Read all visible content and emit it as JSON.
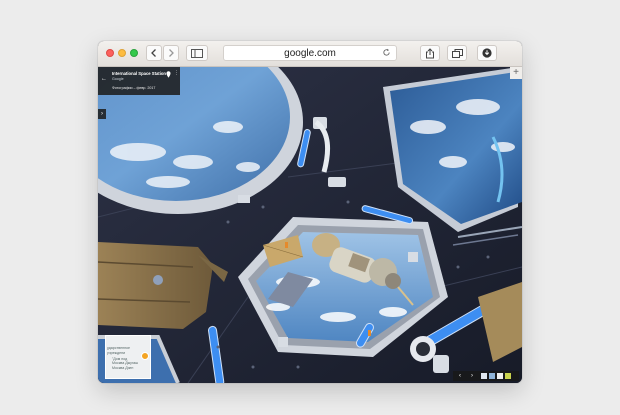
{
  "browser": {
    "url": "google.com",
    "icons": {
      "back": "chevron-left-icon",
      "forward": "chevron-right-icon",
      "sidebar": "sidebar-icon",
      "reload": "reload-icon",
      "share": "share-icon",
      "tabs": "tabs-icon",
      "downloads": "download-icon",
      "new_tab": "plus-icon"
    },
    "traffic_lights": [
      "#fc605c",
      "#fdbc40",
      "#34c84a"
    ]
  },
  "streetview": {
    "place_title": "International Space Station",
    "place_subtitle": "Google",
    "photo_date": "Фотографии – февр. 2017",
    "close_glyph": "×",
    "minimap_labels": [
      "ударственное",
      "учреждени",
      "\"Дом под",
      "Москва Джугаш",
      "Москва Дзен"
    ]
  },
  "colors": {
    "earth_blue": "#4d7fb8",
    "hull": "#23283a",
    "accent_blue": "#3d8ef2"
  }
}
